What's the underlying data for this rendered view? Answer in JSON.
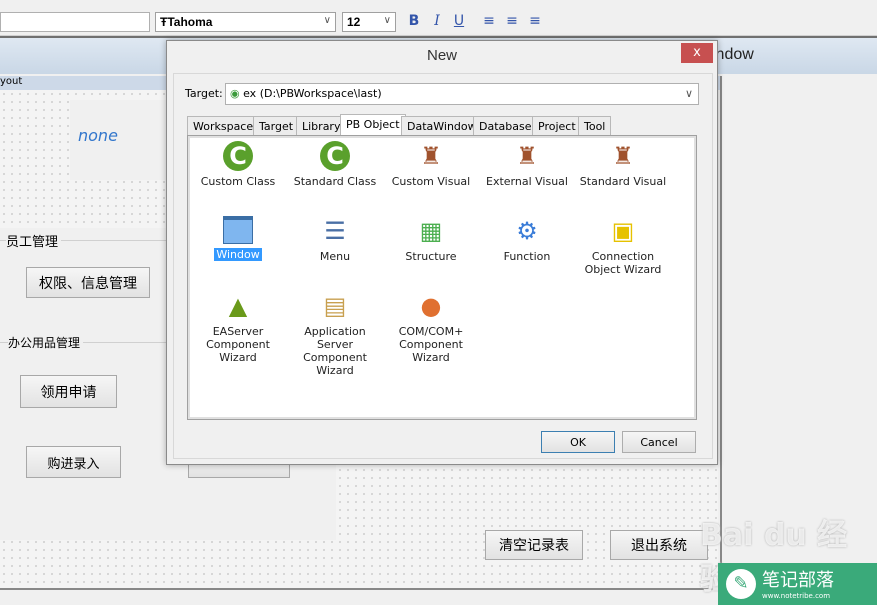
{
  "toolbar": {
    "font": "Tahoma",
    "font_size": "12",
    "bold": "B",
    "italic": "I",
    "underline": "U"
  },
  "window": {
    "title_fragment": "indow",
    "layout_fragment": "yout"
  },
  "canvas": {
    "none_label": "none",
    "group1": "员工管理",
    "btn_permissions": "权限、信息管理",
    "group2": "办公用品管理",
    "btn_requisition": "领用申请",
    "btn_purchase": "购进录入",
    "btn_clear": "清空记录表",
    "btn_exit": "退出系统"
  },
  "dialog": {
    "title": "New",
    "close": "x",
    "target_label": "Target:",
    "target_value": "ex (D:\\PBWorkspace\\last)",
    "tabs": [
      "Workspace",
      "Target",
      "Library",
      "PB Object",
      "DataWindow",
      "Database",
      "Project",
      "Tool"
    ],
    "active_tab": "PB Object",
    "items": [
      {
        "label": "Custom Class",
        "icon": "custom-class-icon"
      },
      {
        "label": "Standard Class",
        "icon": "standard-class-icon"
      },
      {
        "label": "Custom Visual",
        "icon": "custom-visual-icon"
      },
      {
        "label": "External Visual",
        "icon": "external-visual-icon"
      },
      {
        "label": "Standard Visual",
        "icon": "standard-visual-icon"
      },
      {
        "label": "Window",
        "icon": "window-icon",
        "selected": true
      },
      {
        "label": "Menu",
        "icon": "menu-icon"
      },
      {
        "label": "Structure",
        "icon": "structure-icon"
      },
      {
        "label": "Function",
        "icon": "function-icon"
      },
      {
        "label": "Connection Object Wizard",
        "icon": "connection-wizard-icon"
      },
      {
        "label": "EAServer Component Wizard",
        "icon": "easerver-wizard-icon"
      },
      {
        "label": "Application Server Component Wizard",
        "icon": "appserver-wizard-icon"
      },
      {
        "label": "COM/COM+ Component Wizard",
        "icon": "com-wizard-icon"
      }
    ],
    "ok": "OK",
    "cancel": "Cancel"
  },
  "watermark": {
    "text": "Bai du 经验",
    "logo": "笔记部落",
    "url": "www.notetribe.com"
  }
}
